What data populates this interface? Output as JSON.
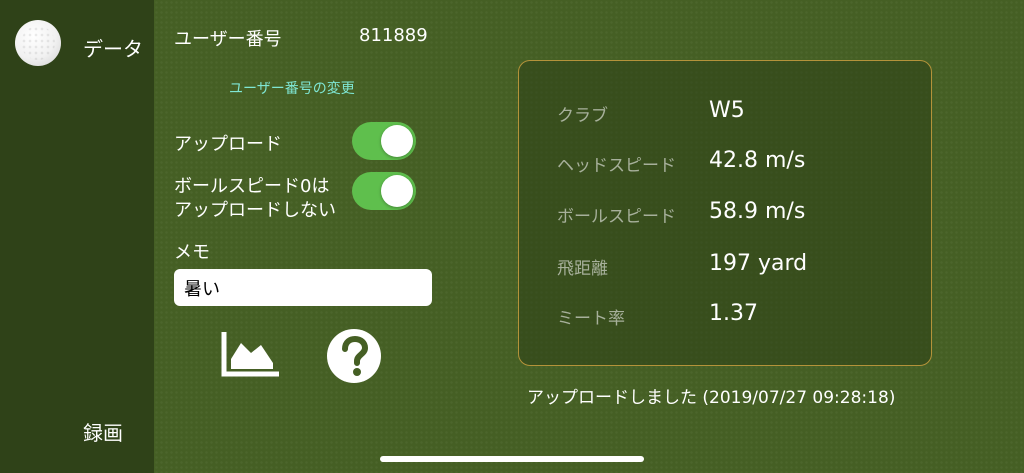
{
  "sidebar": {
    "items": [
      {
        "label": "データ",
        "icon": "golf-ball-icon"
      },
      {
        "label": "録画"
      }
    ]
  },
  "settings": {
    "user_number_label": "ユーザー番号",
    "user_number_value": "811889",
    "change_user_number_link": "ユーザー番号の変更",
    "upload_label": "アップロード",
    "upload_enabled": true,
    "skip_zero_line1": "ボールスピード0は",
    "skip_zero_line2": "アップロードしない",
    "skip_zero_enabled": true,
    "memo_label": "メモ",
    "memo_value": "暑い",
    "chart_icon": "area-chart-icon",
    "help_icon": "help-circle-icon"
  },
  "shot": {
    "rows": [
      {
        "label": "クラブ",
        "value": "W5"
      },
      {
        "label": "ヘッドスピード",
        "value": "42.8 m/s"
      },
      {
        "label": "ボールスピード",
        "value": "58.9 m/s"
      },
      {
        "label": "飛距離",
        "value": "197 yard"
      },
      {
        "label": "ミート率",
        "value": "1.37"
      }
    ]
  },
  "status": "アップロードしました (2019/07/27 09:28:18)",
  "colors": {
    "background": "#455f24",
    "sidebar": "#2f4218",
    "toggle_on": "#5fbf4d",
    "link": "#7fe6d4",
    "panel_border": "#b4933a"
  }
}
